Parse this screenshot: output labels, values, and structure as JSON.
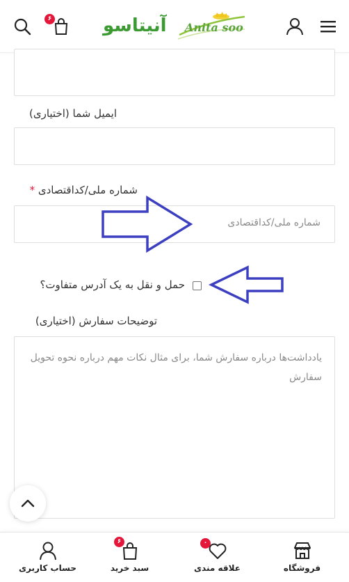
{
  "header": {
    "logo_text_fa": "آنیتاسو",
    "logo_text_en": "Anita soo",
    "cart_badge": "۶",
    "icons": [
      "search-icon",
      "cart-icon",
      "user-icon",
      "menu-icon"
    ]
  },
  "form": {
    "email_label": "ایمیل شما (اختیاری)",
    "national_id_label": "شماره ملی/کداقتصادی",
    "national_id_required": "*",
    "national_id_placeholder": "شماره ملی/کداقتصادی",
    "ship_different_label": "حمل و نقل به یک آدرس متفاوت؟",
    "order_notes_label": "توضیحات سفارش (اختیاری)",
    "order_notes_placeholder": "یادداشت‌ها درباره سفارش شما، برای مثال نکات مهم درباره نحوه تحویل سفارش"
  },
  "bottom_nav": {
    "items": [
      {
        "label": "حساب کاربری",
        "icon": "user-icon"
      },
      {
        "label": "سبد خرید",
        "icon": "cart-icon",
        "badge": "۶"
      },
      {
        "label": "علاقه مندی",
        "icon": "heart-icon",
        "badge": "۰"
      },
      {
        "label": "فروشگاه",
        "icon": "store-icon"
      }
    ]
  },
  "colors": {
    "accent_green": "#3c9a33",
    "badge_red": "#e4163a",
    "annotation_blue": "#3b3fc0"
  }
}
